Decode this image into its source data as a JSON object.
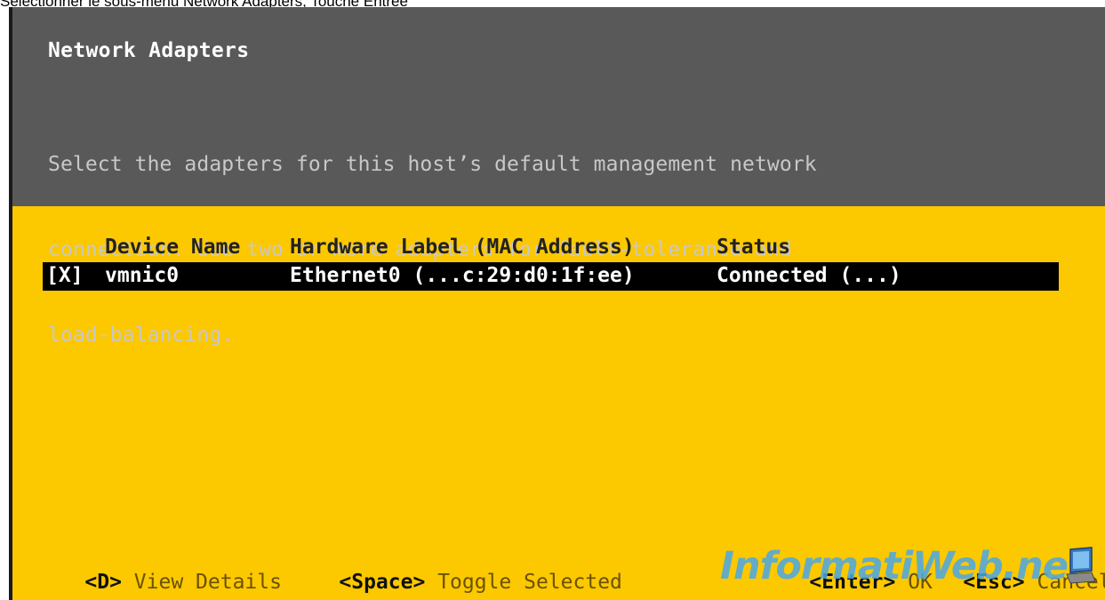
{
  "caption": "Sélectionner le sous-menu Network Adapters, Touche Entrée",
  "header": {
    "title": "Network Adapters",
    "description_lines": [
      "Select the adapters for this host’s default management network",
      "connection. Use two or more adapters for fault-tolerance and",
      "load-balancing."
    ]
  },
  "table": {
    "columns": [
      "Device Name",
      "Hardware Label (MAC Address)",
      "Status"
    ],
    "rows": [
      {
        "checkbox": "[X]",
        "device": "vmnic0",
        "hardware_label": "Ethernet0 (...c:29:d0:1f:ee)",
        "status": "Connected (...)"
      }
    ]
  },
  "footer": {
    "view_details_key": "<D>",
    "view_details_label": "View Details",
    "toggle_key": "<Space>",
    "toggle_label": "Toggle Selected",
    "ok_key": "<Enter>",
    "ok_label": "OK",
    "cancel_key": "<Esc>",
    "cancel_label": "Cancel"
  },
  "watermark": "InformatiWeb.net",
  "colors": {
    "header_bg": "#595959",
    "body_bg": "#fcc800",
    "selection_bg": "#000000",
    "watermark": "#4aa8e8"
  }
}
